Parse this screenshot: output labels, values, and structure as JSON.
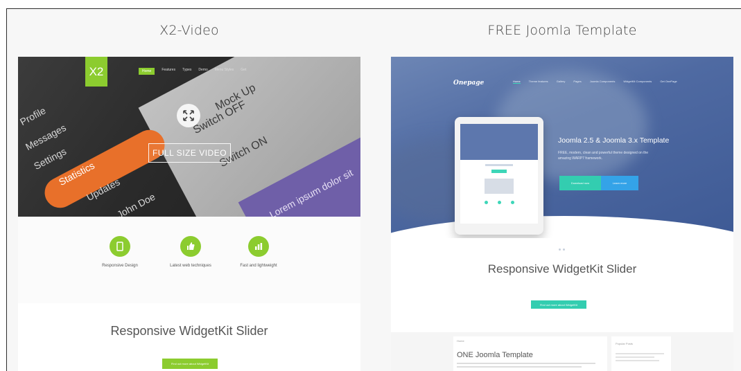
{
  "cards": [
    {
      "title": "X2-Video",
      "preview": {
        "logo": "X2",
        "nav": [
          "Home",
          "Features",
          "Types",
          "Demo",
          "Menu Styles",
          "Get"
        ],
        "hero_button": "FULL SIZE VIDEO",
        "hero_ui_labels": [
          "Profile",
          "Messages",
          "Settings",
          "Statistics",
          "Updates",
          "John Doe",
          "Mock Up",
          "Switch OFF",
          "Switch ON",
          "Lorem ipsum dolor sit"
        ],
        "features": [
          {
            "icon": "tablet-icon",
            "title": "Responsive Design"
          },
          {
            "icon": "thumbs-up-icon",
            "title": "Latest web techniques"
          },
          {
            "icon": "bar-chart-icon",
            "title": "Fast and lightweight"
          }
        ],
        "section_title": "Responsive WidgetKit Slider",
        "cta_label": "Find out more about WidgetKit"
      }
    },
    {
      "title": "FREE Joomla Template",
      "preview": {
        "logo": "Onepage",
        "nav": [
          "Home",
          "Theme features",
          "Gallery",
          "Pages",
          "Joomla Components",
          "WidgetKit Components",
          "Get OnePage"
        ],
        "headline": "Joomla 2.5 & Joomla 3.x Template",
        "sub": "FREE, modern, clean and powerful theme designed on the amazing WARP7 framework.",
        "btn_primary": "Download now",
        "btn_secondary": "Learn more",
        "section_title": "Responsive WidgetKit Slider",
        "cta_label": "Find out more about WidgetKit",
        "breadcrumb": "Home",
        "article_title": "ONE Joomla Template",
        "sidebar_title": "Popular Posts"
      }
    }
  ],
  "colors": {
    "accent_green": "#8ccc2f",
    "accent_teal": "#33cdb0",
    "accent_blue": "#34a3e8",
    "hero_blue": "#4f6aa2",
    "hero_orange": "#e8702a"
  }
}
